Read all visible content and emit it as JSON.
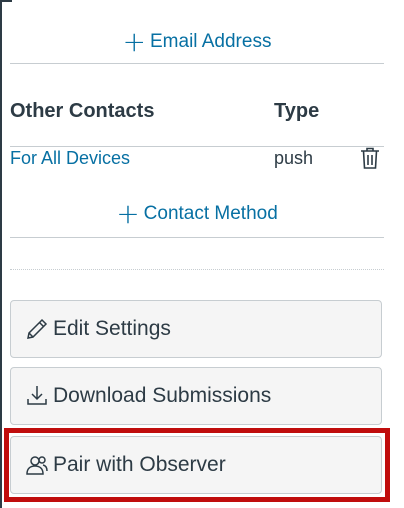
{
  "email": {
    "add_label": "Email Address"
  },
  "other_contacts": {
    "header_name": "Other Contacts",
    "header_type": "Type",
    "rows": [
      {
        "name": "For All Devices",
        "type": "push"
      }
    ],
    "add_label": "Contact Method"
  },
  "actions": {
    "edit_settings": "Edit Settings",
    "download_submissions": "Download Submissions",
    "pair_with_observer": "Pair with Observer"
  },
  "colors": {
    "link": "#0770a3",
    "text": "#2d3b45",
    "button_bg": "#f5f5f5",
    "highlight": "#c00d0d"
  },
  "icons": [
    "plus-icon",
    "trash-icon",
    "pencil-icon",
    "download-icon",
    "observer-icon"
  ]
}
